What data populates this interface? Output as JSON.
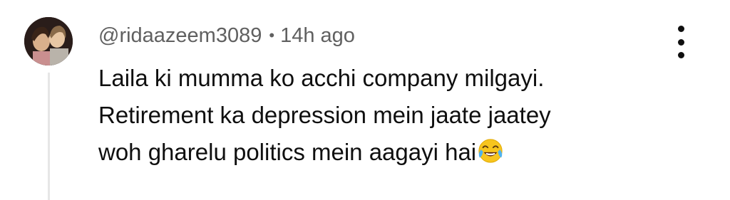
{
  "comment": {
    "username": "@ridaazeem3089",
    "separator": "•",
    "timestamp": "14h ago",
    "lines": [
      "Laila ki mumma ko acchi company milgayi.",
      "Retirement ka depression mein jaate jaatey",
      "woh gharelu politics mein aagayi hai"
    ],
    "emoji": "face-with-tears-of-joy-icon"
  },
  "icons": {
    "more": "vertical-ellipsis-icon",
    "avatar": "avatar"
  },
  "colors": {
    "meta_text": "#606060",
    "body_text": "#0f0f0f",
    "thread_line": "#e6e6e6"
  }
}
